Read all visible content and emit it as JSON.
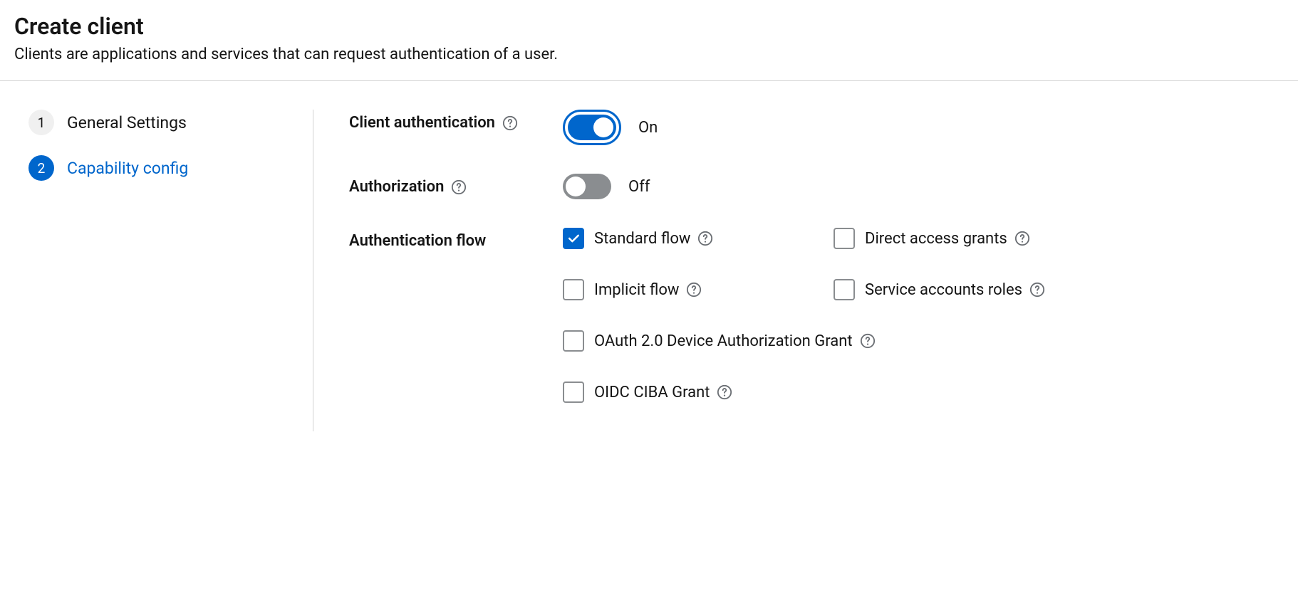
{
  "header": {
    "title": "Create client",
    "description": "Clients are applications and services that can request authentication of a user."
  },
  "wizard": {
    "steps": [
      {
        "number": "1",
        "label": "General Settings",
        "active": false
      },
      {
        "number": "2",
        "label": "Capability config",
        "active": true
      }
    ]
  },
  "form": {
    "client_auth": {
      "label": "Client authentication",
      "value": true,
      "value_label": "On"
    },
    "authorization": {
      "label": "Authorization",
      "value": false,
      "value_label": "Off"
    },
    "auth_flow": {
      "label": "Authentication flow",
      "options": {
        "standard": {
          "label": "Standard flow",
          "checked": true
        },
        "direct_access": {
          "label": "Direct access grants",
          "checked": false
        },
        "implicit": {
          "label": "Implicit flow",
          "checked": false
        },
        "service_accounts": {
          "label": "Service accounts roles",
          "checked": false
        },
        "oauth_device": {
          "label": "OAuth 2.0 Device Authorization Grant",
          "checked": false
        },
        "oidc_ciba": {
          "label": "OIDC CIBA Grant",
          "checked": false
        }
      }
    }
  }
}
